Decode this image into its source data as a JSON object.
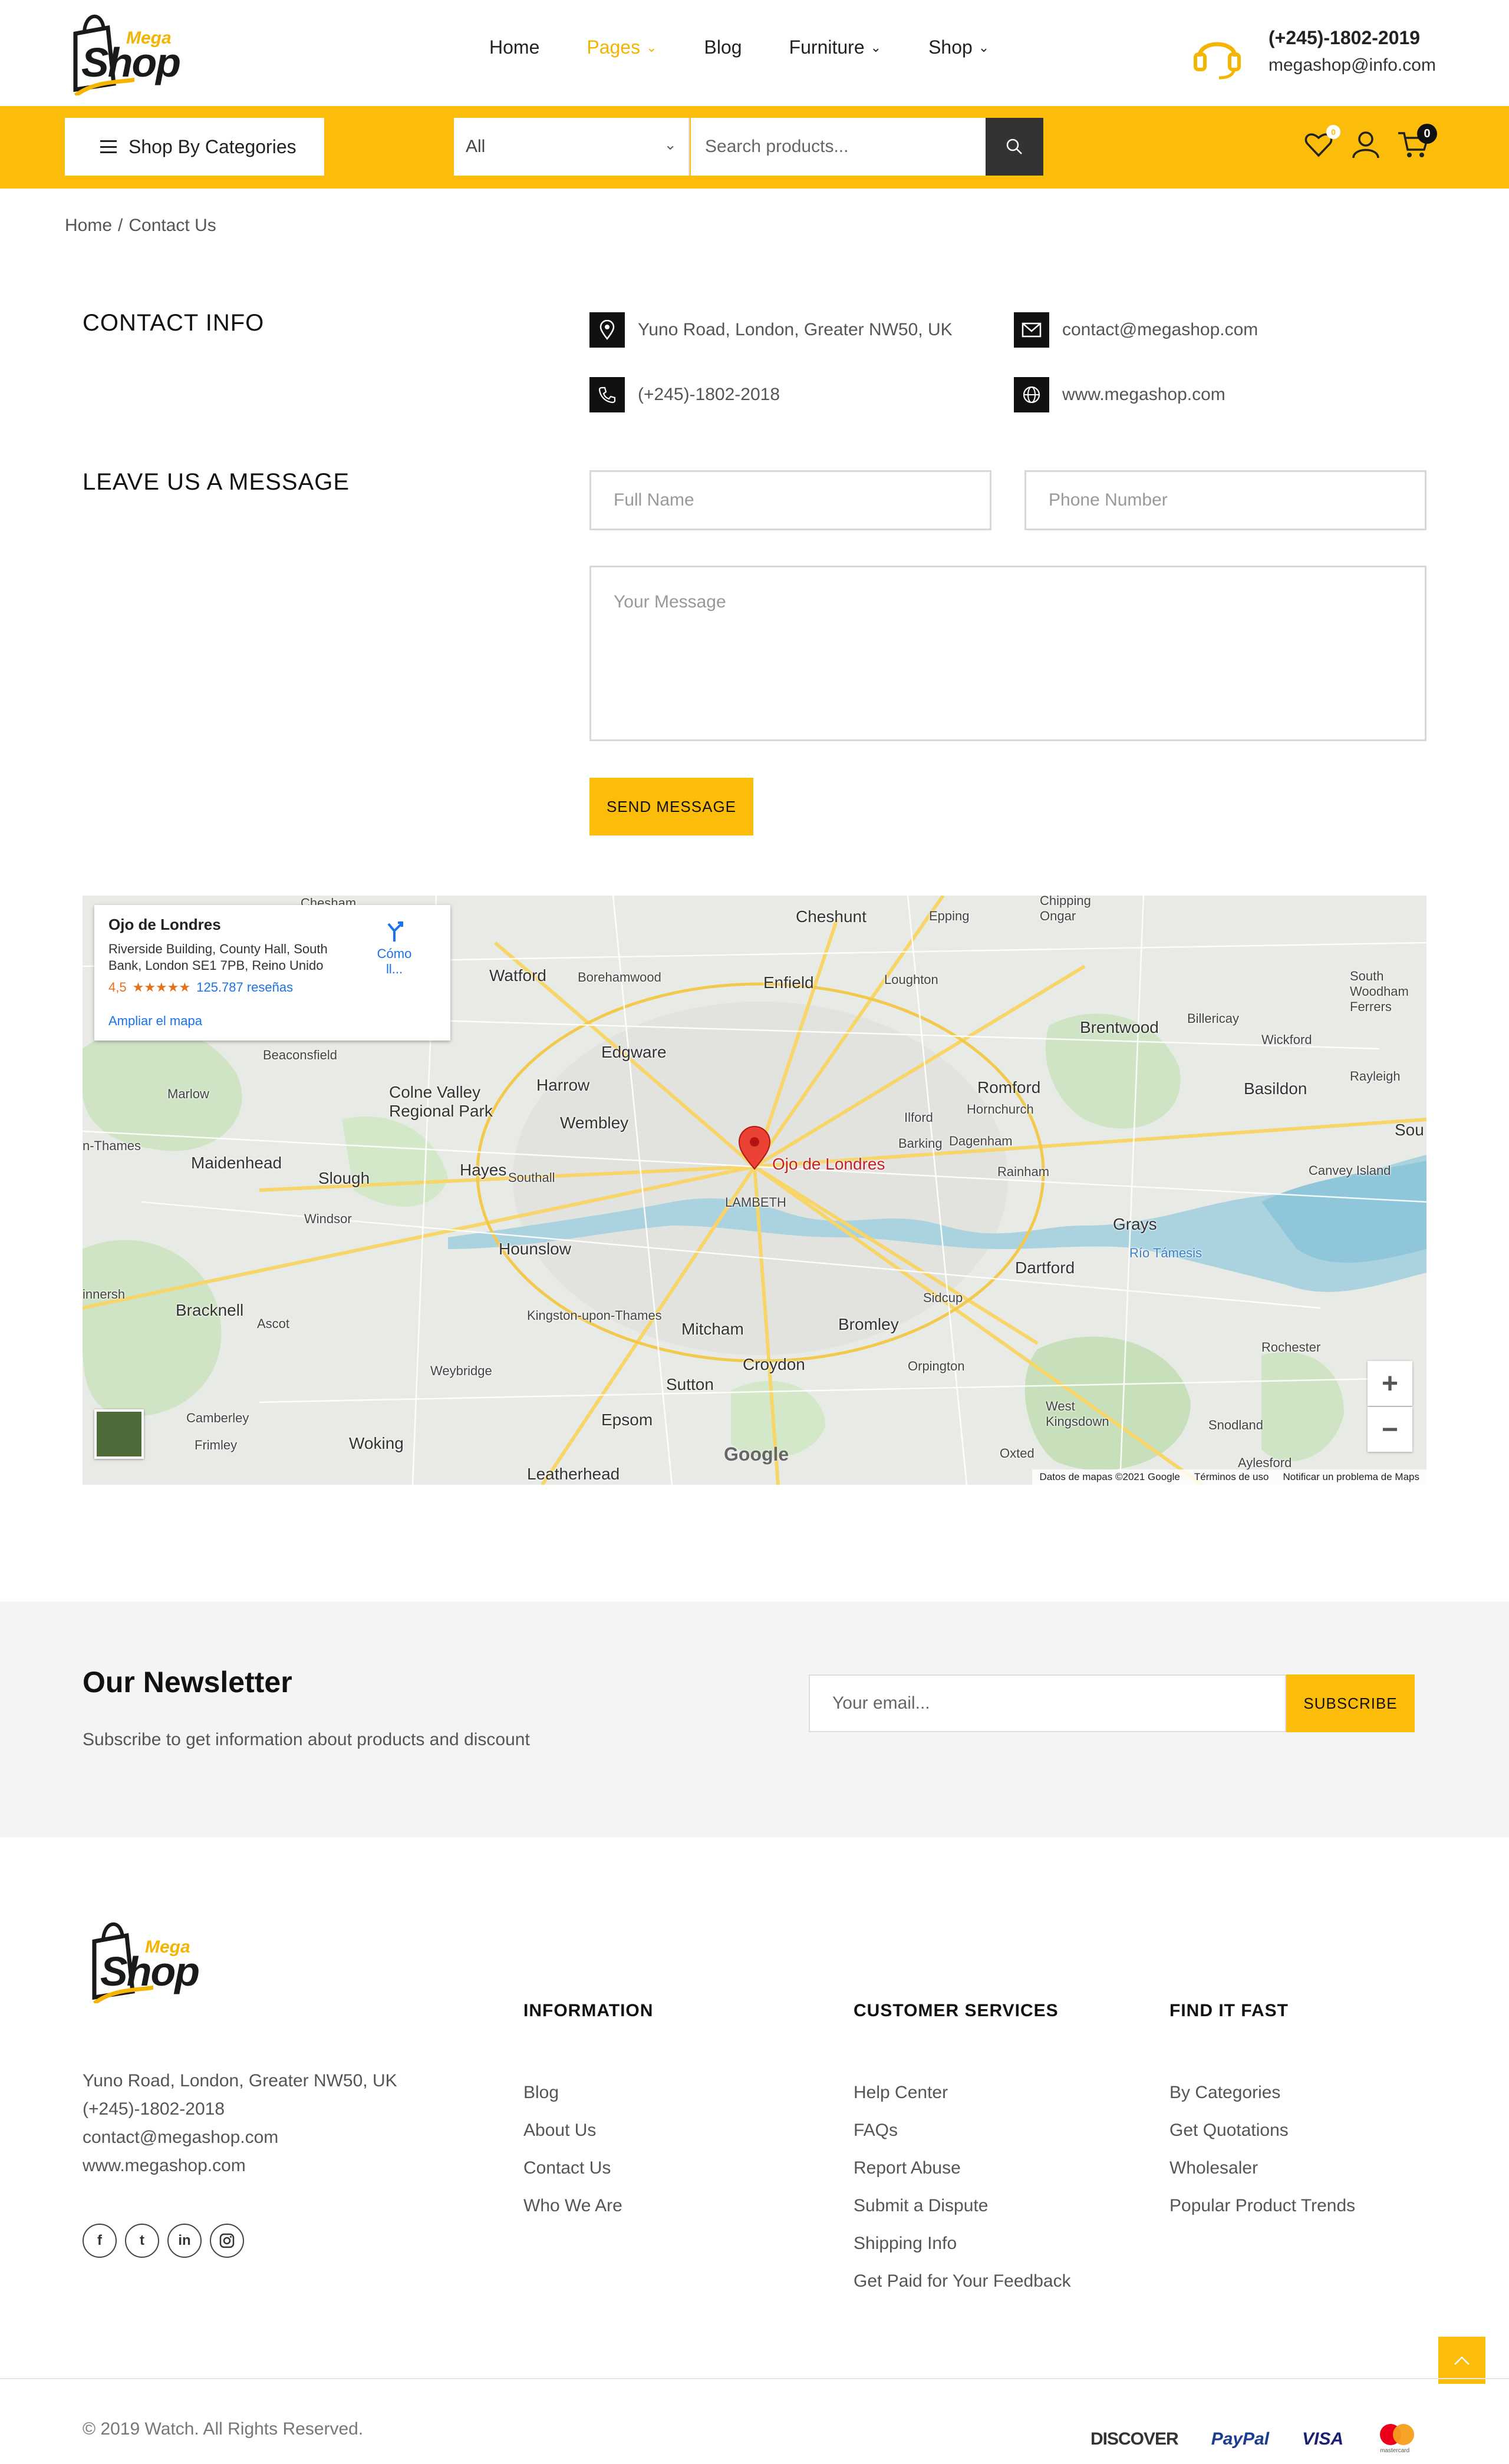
{
  "header": {
    "logo": {
      "small": "Mega",
      "big": "Shop"
    },
    "nav": [
      {
        "label": "Home",
        "has_dropdown": false,
        "active": false
      },
      {
        "label": "Pages",
        "has_dropdown": true,
        "active": true
      },
      {
        "label": "Blog",
        "has_dropdown": false,
        "active": false
      },
      {
        "label": "Furniture",
        "has_dropdown": true,
        "active": false
      },
      {
        "label": "Shop",
        "has_dropdown": true,
        "active": false
      }
    ],
    "phone": "(+245)-1802-2019",
    "email": "megashop@info.com",
    "accent_color": "#fbbd0a"
  },
  "toolbar": {
    "categories_label": "Shop By Categories",
    "select_value": "All",
    "search_placeholder": "Search products...",
    "wishlist_count": "0",
    "cart_count": "0"
  },
  "breadcrumb": {
    "home": "Home",
    "separator": "/",
    "current": "Contact Us"
  },
  "contact": {
    "info_title": "CONTACT INFO",
    "address": "Yuno Road, London, Greater NW50, UK",
    "email": "contact@megashop.com",
    "phone": "(+245)-1802-2018",
    "website": "www.megashop.com",
    "message_title": "LEAVE US A MESSAGE",
    "name_placeholder": "Full Name",
    "phone_placeholder": "Phone Number",
    "message_placeholder": "Your Message",
    "send_label": "SEND MESSAGE"
  },
  "map": {
    "place_name": "Ojo de Londres",
    "place_address": "Riverside Building, County Hall, South Bank, London SE1 7PB, Reino Unido",
    "rating": "4,5",
    "stars": "★★★★★",
    "reviews": "125.787 reseñas",
    "directions": "Cómo ll...",
    "enlarge": "Ampliar el mapa",
    "marker_label": "Ojo de Londres",
    "google_logo": "Google",
    "footer_data": "Datos de mapas ©2021 Google",
    "footer_terms": "Términos de uso",
    "footer_report": "Notificar un problema de Maps",
    "zoom_in": "+",
    "zoom_out": "−",
    "labels": [
      "Watford",
      "Cheshunt",
      "Enfield",
      "Borehamwood",
      "Loughton",
      "Epping",
      "Brentwood",
      "Billericay",
      "Wickford",
      "Harrow",
      "Edgware",
      "Wembley",
      "Romford",
      "Hornchurch",
      "Basildon",
      "Rayleigh",
      "Colne Valley Regional Park",
      "Beaconsfield",
      "Marlow",
      "Maidenhead",
      "Slough",
      "Hayes",
      "Southall",
      "Windsor",
      "Ilford",
      "Barking",
      "Dagenham",
      "Rainham",
      "Canvey Island",
      "LAMBETH",
      "Hounslow",
      "Grays",
      "Río Támesis",
      "Dartford",
      "Bracknell",
      "Ascot",
      "Kingston-upon-Thames",
      "Mitcham",
      "Bromley",
      "Sidcup",
      "Orpington",
      "Croydon",
      "Sutton",
      "Weybridge",
      "Epsom",
      "Camberley",
      "Frimley",
      "Woking",
      "Leatherhead",
      "Oxted",
      "Rochester",
      "West Kingsdown",
      "Snodland",
      "Aylesford",
      "South Woodham Ferrers",
      "Chipping Ongar",
      "Chesham",
      "Sou"
    ]
  },
  "newsletter": {
    "title": "Our Newsletter",
    "subtitle": "Subscribe to get information about products and discount",
    "email_placeholder": "Your email...",
    "subscribe_label": "SUBSCRIBE"
  },
  "footer": {
    "logo": {
      "small": "Mega",
      "big": "Shop"
    },
    "address": "Yuno Road, London, Greater NW50, UK",
    "phone": "(+245)-1802-2018",
    "email": "contact@megashop.com",
    "website": "www.megashop.com",
    "socials": [
      "f",
      "t",
      "in",
      "ig"
    ],
    "columns": [
      {
        "title": "INFORMATION",
        "links": [
          "Blog",
          "About Us",
          "Contact Us",
          "Who We Are"
        ]
      },
      {
        "title": "CUSTOMER SERVICES",
        "links": [
          "Help Center",
          "FAQs",
          "Report Abuse",
          "Submit a Dispute",
          "Shipping Info",
          "Get Paid for Your Feedback"
        ]
      },
      {
        "title": "FIND IT FAST",
        "links": [
          "By Categories",
          "Get Quotations",
          "Wholesaler",
          "Popular Product Trends"
        ]
      }
    ],
    "copyright": "© 2019 Watch. All Rights Reserved.",
    "payments": [
      "DISCOVER",
      "PayPal",
      "VISA",
      "mastercard"
    ]
  }
}
